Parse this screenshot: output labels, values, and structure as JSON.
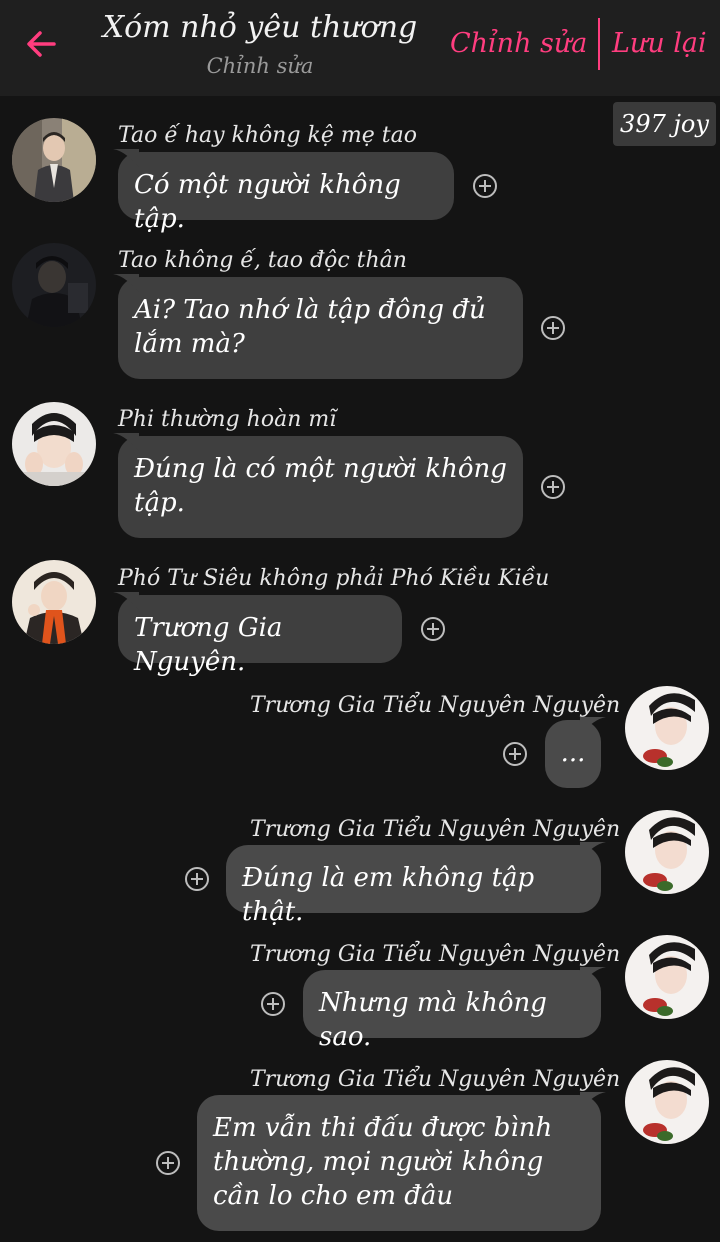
{
  "header": {
    "title": "Xóm nhỏ yêu thương",
    "subtitle": "Chỉnh sửa",
    "edit_label": "Chỉnh sửa",
    "save_label": "Lưu lại",
    "accent_color": "#ff3d7f"
  },
  "joy_badge": "397 joy",
  "messages": [
    {
      "side": "left",
      "name": "Tao ế hay không kệ mẹ tao",
      "text": "Có một người không tập."
    },
    {
      "side": "left",
      "name": "Tao không ế, tao độc thân",
      "text": "Ai? Tao nhớ là tập đông đủ lắm mà?"
    },
    {
      "side": "left",
      "name": "Phi thường hoàn mĩ",
      "text": "Đúng là có một người không tập."
    },
    {
      "side": "left",
      "name": "Phó Tư Siêu không phải Phó Kiều Kiều",
      "text": "Trương Gia Nguyên."
    },
    {
      "side": "right",
      "name": "Trương Gia Tiểu Nguyên Nguyên",
      "text": "..."
    },
    {
      "side": "right",
      "name": "Trương Gia Tiểu Nguyên Nguyên",
      "text": "Đúng là em không tập thật."
    },
    {
      "side": "right",
      "name": "Trương Gia Tiểu Nguyên Nguyên",
      "text": "Nhưng mà không sao."
    },
    {
      "side": "right",
      "name": "Trương Gia Tiểu Nguyên Nguyên",
      "text": "Em vẫn thi đấu được bình thường, mọi người không cần lo cho em đâu"
    }
  ]
}
